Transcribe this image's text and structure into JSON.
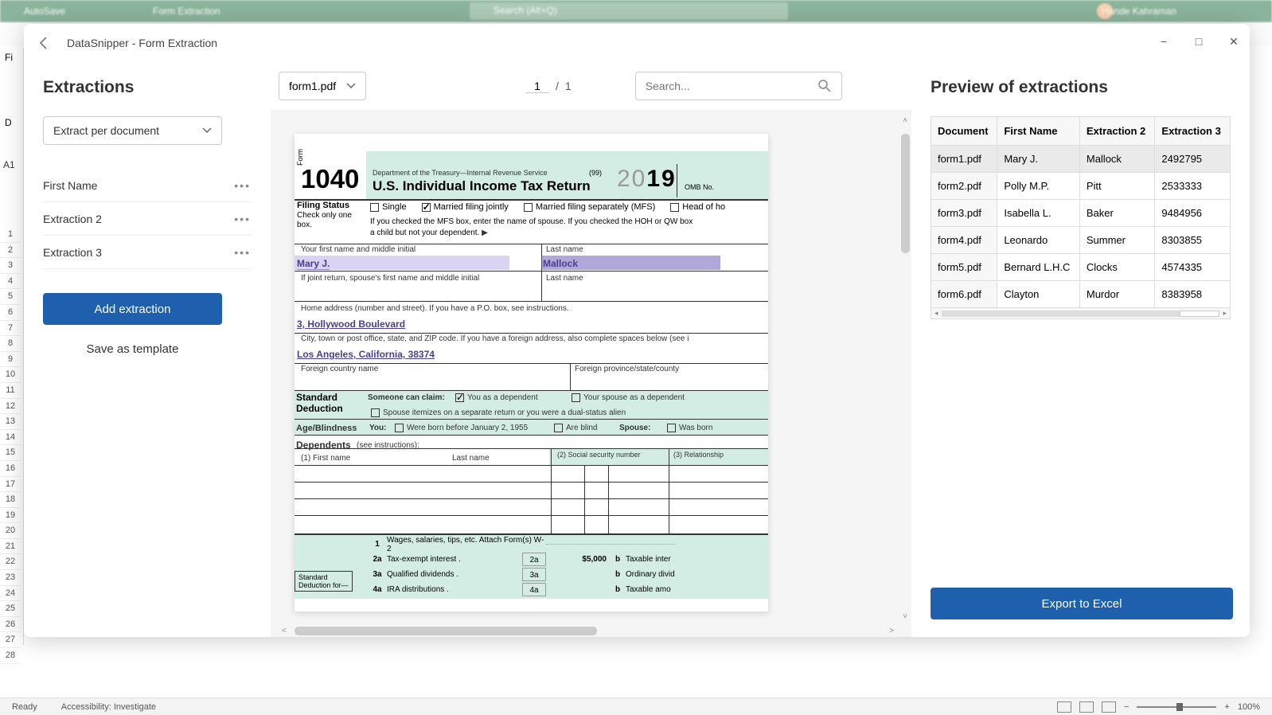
{
  "excel": {
    "autosave": "AutoSave",
    "ribbon_tab": "Form Extraction",
    "search_placeholder": "Search (Alt+Q)",
    "user_name": "Hande Kahraman",
    "cell_ref": "A1",
    "col_d": "D",
    "status_ready": "Ready",
    "status_access": "Accessibility: Investigate",
    "zoom": "100%",
    "file_tab": "Fi"
  },
  "modal": {
    "title": "DataSnipper - Form Extraction"
  },
  "left": {
    "heading": "Extractions",
    "mode": "Extract per document",
    "items": [
      "First Name",
      "Extraction 2",
      "Extraction 3"
    ],
    "add_btn": "Add extraction",
    "save_template": "Save as template"
  },
  "center": {
    "doc": "form1.pdf",
    "page_current": "1",
    "page_sep": "/",
    "page_total": "1",
    "search_placeholder": "Search..."
  },
  "form": {
    "form_tag": "Form",
    "num": "1040",
    "dept": "Department of the Treasury—Internal Revenue Service",
    "title": "U.S. Individual Income Tax Return",
    "n99": "(99)",
    "year_prefix": "20",
    "year": "19",
    "omb": "OMB No.",
    "filing_status_label": "Filing Status",
    "check_only": "Check only one box.",
    "single": "Single",
    "mfj": "Married filing jointly",
    "mfs": "Married filing separately (MFS)",
    "hoh": "Head of ho",
    "filing_note": "If you checked the MFS box, enter the name of spouse. If you checked the HOH or QW box",
    "filing_note2": "a child but not your dependent.",
    "arrow": "▶",
    "first_name_label": "Your first name and middle initial",
    "last_name_label": "Last name",
    "first_name_value": "Mary J.",
    "last_name_value": "Mallock",
    "spouse_first_label": "If joint return, spouse's first name and middle initial",
    "spouse_last_label": "Last name",
    "address_label": "Home address (number and street). If you have a P.O. box, see instructions.",
    "address_value": "3, Hollywood Boulevard",
    "city_label": "City, town or post office, state, and ZIP code. If you have a foreign address, also complete spaces below (see i",
    "city_value": "Los Angeles, California, 38374",
    "foreign_country": "Foreign country name",
    "foreign_province": "Foreign province/state/county",
    "std_ded": "Standard Deduction",
    "someone_claim": "Someone can claim:",
    "you_dependent": "You as a dependent",
    "spouse_dependent": "Your spouse as a dependent",
    "spouse_itemizes": "Spouse itemizes on a separate return or you were a dual-status alien",
    "age_blind": "Age/Blindness",
    "you_label": "You:",
    "born_before": "Were born before January 2, 1955",
    "are_blind": "Are blind",
    "spouse_label": "Spouse:",
    "was_born": "Was born",
    "dependents": "Dependents",
    "see_instr": "(see instructions):",
    "dep_first": "(1)  First name",
    "dep_last": "Last name",
    "dep_ssn": "(2)  Social security number",
    "dep_rel": "(3)  Relationship",
    "std_ded_box1": "Standard",
    "std_ded_box2": "Deduction for—",
    "line1": "1",
    "line1_label": "Wages, salaries, tips, etc. Attach Form(s) W-2",
    "line2a": "2a",
    "line2a_label": "Tax-exempt interest .",
    "line2a_cell": "2a",
    "line2a_val": "$5,000",
    "line2b": "b",
    "line2b_label": "Taxable inter",
    "line3a": "3a",
    "line3a_label": "Qualified dividends .",
    "line3a_cell": "3a",
    "line3b": "b",
    "line3b_label": "Ordinary divid",
    "line4a": "4a",
    "line4a_label": "IRA distributions .",
    "line4a_cell": "4a",
    "line4b": "b",
    "line4b_label": "Taxable amo"
  },
  "right": {
    "heading": "Preview of extractions",
    "headers": [
      "Document",
      "First Name",
      "Extraction 2",
      "Extraction 3"
    ],
    "rows": [
      [
        "form1.pdf",
        "Mary J.",
        "Mallock",
        "2492795"
      ],
      [
        "form2.pdf",
        "Polly M.P.",
        "Pitt",
        "2533333"
      ],
      [
        "form3.pdf",
        "Isabella L.",
        "Baker",
        "9484956"
      ],
      [
        "form4.pdf",
        "Leonardo",
        "Summer",
        "8303855"
      ],
      [
        "form5.pdf",
        "Bernard L.H.C",
        "Clocks",
        "4574335"
      ],
      [
        "form6.pdf",
        "Clayton",
        "Murdor",
        "8383958"
      ]
    ],
    "export_btn": "Export to Excel"
  }
}
